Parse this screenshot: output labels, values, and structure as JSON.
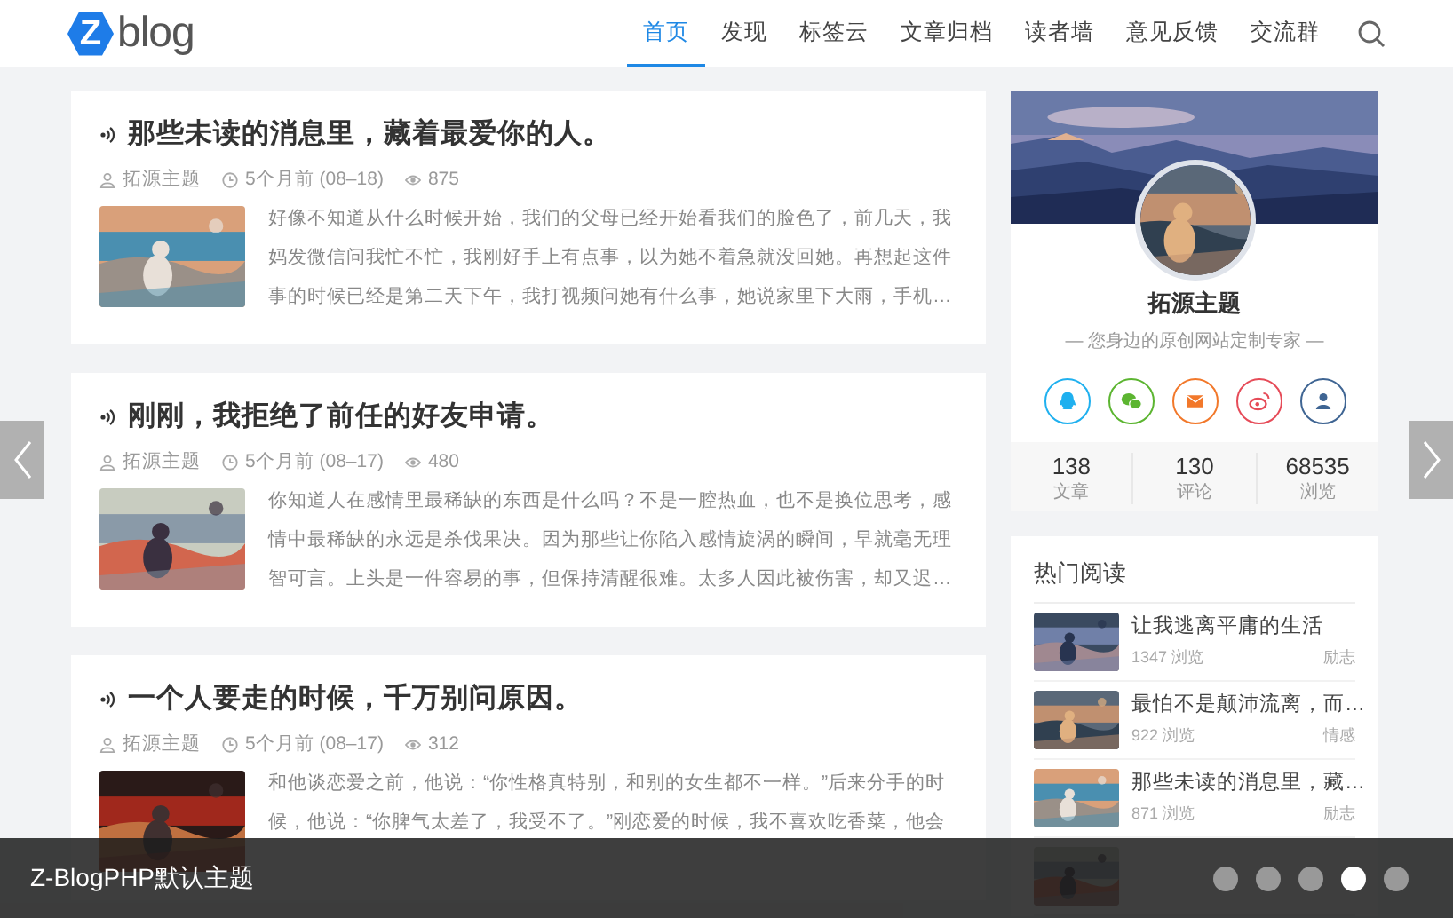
{
  "header": {
    "logo": {
      "mark": "Z",
      "text": "blog"
    },
    "nav": [
      {
        "label": "首页",
        "selected": true
      },
      {
        "label": "发现",
        "selected": false
      },
      {
        "label": "标签云",
        "selected": false
      },
      {
        "label": "文章归档",
        "selected": false
      },
      {
        "label": "读者墙",
        "selected": false
      },
      {
        "label": "意见反馈",
        "selected": false
      },
      {
        "label": "交流群",
        "selected": false
      }
    ]
  },
  "posts": [
    {
      "title": "那些未读的消息里，藏着最爱你的人。",
      "author": "拓源主题",
      "time": "5个月前 (08–18)",
      "views": "875",
      "excerpt": "好像不知道从什么时候开始，我们的父母已经开始看我们的脸色了，前几天，我妈发微信问我忙不忙，我刚好手上有点事，以为她不着急就没回她。再想起这件事的时候已经是第二天下午，我打视频问她有什么事，她说家里下大雨，手机…",
      "thumb": {
        "kind": "picture"
      }
    },
    {
      "title": "刚刚，我拒绝了前任的好友申请。",
      "author": "拓源主题",
      "time": "5个月前 (08–17)",
      "views": "480",
      "excerpt": "你知道人在感情里最稀缺的东西是什么吗？不是一腔热血，也不是换位思考，感情中最稀缺的永远是杀伐果决。因为那些让你陷入感情旋涡的瞬间，早就毫无理智可言。上头是一件容易的事，但保持清醒很难。太多人因此被伤害，却又迟…",
      "thumb": {
        "kind": "picture"
      }
    },
    {
      "title": "一个人要走的时候，千万别问原因。",
      "author": "拓源主题",
      "time": "5个月前 (08–17)",
      "views": "312",
      "excerpt": "和他谈恋爱之前，他说：“你性格真特别，和别的女生都不一样。”后来分手的时候，他说：“你脾气太差了，我受不了。”刚恋爱的时候，我不喜欢吃香菜，他会",
      "thumb": {
        "kind": "picture"
      }
    }
  ],
  "profile": {
    "banner": {
      "kind": "picture"
    },
    "avatar": {
      "kind": "picture"
    },
    "name": "拓源主题",
    "motto": "— 您身边的原创网站定制专家 —",
    "socials": [
      {
        "kind": "qq",
        "color": "#1fb0ef"
      },
      {
        "kind": "wechat",
        "color": "#5cb531"
      },
      {
        "kind": "mail",
        "color": "#f2782a"
      },
      {
        "kind": "weibo",
        "color": "#e64b58"
      },
      {
        "kind": "user",
        "color": "#3f6593"
      }
    ],
    "stats": [
      {
        "value": "138",
        "label": "文章"
      },
      {
        "value": "130",
        "label": "评论"
      },
      {
        "value": "68535",
        "label": "浏览"
      }
    ]
  },
  "hot": {
    "title": "热门阅读",
    "items": [
      {
        "title": "让我逃离平庸的生活",
        "views": "1347 浏览",
        "tag": "励志",
        "thumb": {
          "kind": "picture"
        }
      },
      {
        "title": "最怕不是颠沛流离，而…",
        "views": "922 浏览",
        "tag": "情感",
        "thumb": {
          "kind": "picture"
        }
      },
      {
        "title": "那些未读的消息里，藏…",
        "views": "871 浏览",
        "tag": "励志",
        "thumb": {
          "kind": "picture"
        }
      },
      {
        "thumb": {
          "kind": "picture"
        }
      }
    ]
  },
  "slider": {
    "caption": "Z-BlogPHP默认主题",
    "dots": [
      {
        "selected": false
      },
      {
        "selected": false
      },
      {
        "selected": false
      },
      {
        "selected": true
      },
      {
        "selected": false
      }
    ]
  }
}
